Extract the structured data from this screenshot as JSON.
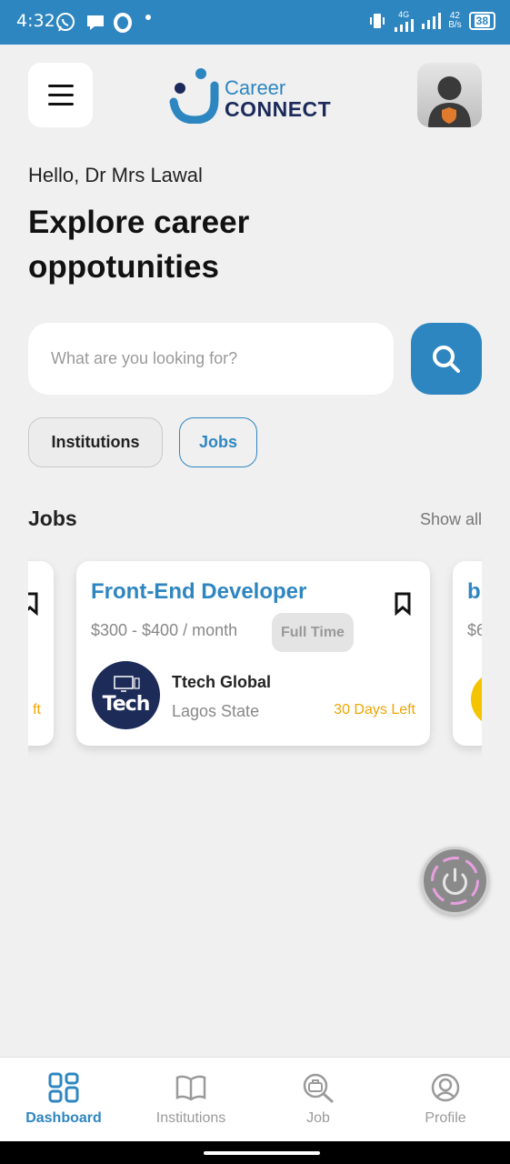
{
  "status_bar": {
    "time": "4:32",
    "network": "4G",
    "speed_value": "42",
    "speed_unit": "B/s",
    "battery": "38"
  },
  "header": {
    "logo_line1": "Career",
    "logo_line2": "CONNECT"
  },
  "greeting": "Hello, Dr Mrs Lawal",
  "headline": "Explore career oppotunities",
  "search": {
    "placeholder": "What are you looking for?"
  },
  "filters": [
    {
      "label": "Institutions",
      "active": false
    },
    {
      "label": "Jobs",
      "active": true
    }
  ],
  "jobs_section": {
    "title": "Jobs",
    "show_all": "Show all"
  },
  "jobs": [
    {
      "title": "Front-End Developer",
      "salary": "$300 - $400 / month",
      "type": "Full Time",
      "company": "Ttech Global",
      "location": "Lagos State",
      "days_left": "30 Days Left",
      "logo_text": "Tech"
    }
  ],
  "partial_cards": {
    "prev_days_left": "ft",
    "next_title": "b",
    "next_salary": "$6"
  },
  "bottom_nav": [
    {
      "label": "Dashboard",
      "icon": "grid-icon",
      "active": true
    },
    {
      "label": "Institutions",
      "icon": "book-icon",
      "active": false
    },
    {
      "label": "Job",
      "icon": "job-search-icon",
      "active": false
    },
    {
      "label": "Profile",
      "icon": "profile-icon",
      "active": false
    }
  ],
  "colors": {
    "primary": "#2e86c1",
    "navy": "#1b2a5b",
    "accent_orange": "#f0a500",
    "background": "#f0f0f0"
  }
}
